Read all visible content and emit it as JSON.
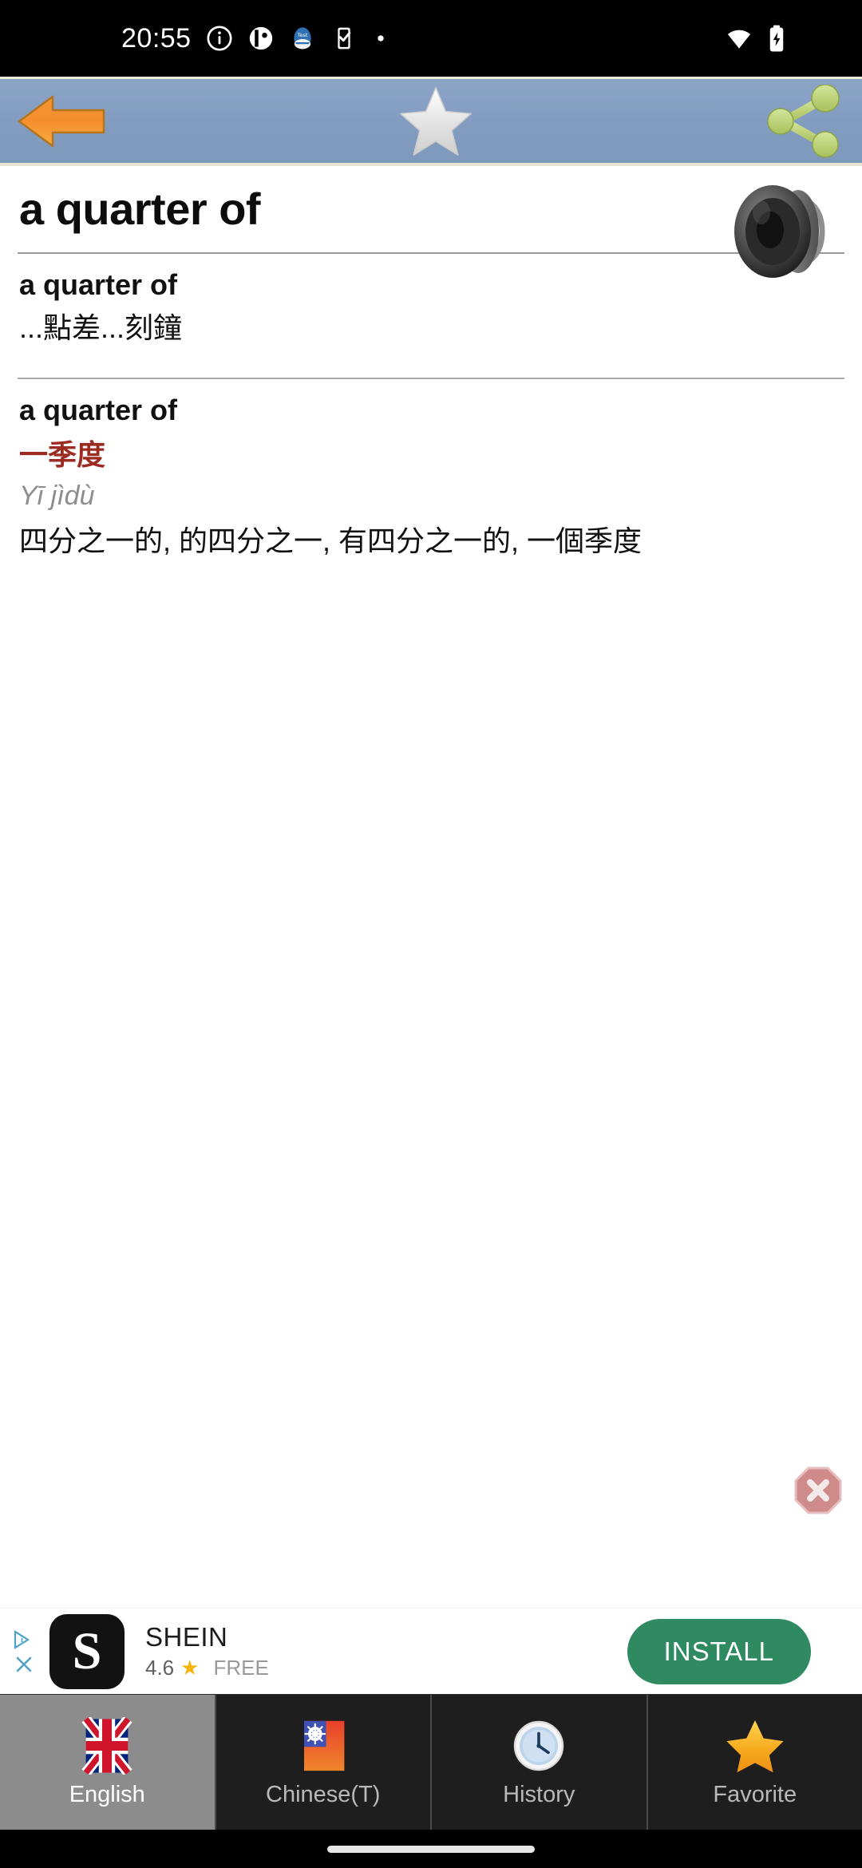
{
  "status_bar": {
    "time": "20:55",
    "left_icons": [
      "info-circle-icon",
      "contacts-icon",
      "app-notification-icon",
      "task-check-icon",
      "dot-icon"
    ],
    "right_icons": [
      "wifi-icon",
      "battery-charging-icon"
    ]
  },
  "toolbar": {
    "back_label": "back-arrow",
    "favorite_label": "star",
    "share_label": "share",
    "background_color": "#829cc0"
  },
  "content": {
    "headword": "a quarter of",
    "speaker_label": "speak",
    "entries": [
      {
        "english": "a quarter of",
        "chinese": "...點差...刻鐘"
      },
      {
        "english": "a quarter of",
        "chinese_red": "一季度",
        "pinyin": "Yī jìdù",
        "definitions": "四分之一的, 的四分之一, 有四分之一的, 一個季度"
      }
    ],
    "accent_red": "#9c2b22"
  },
  "ad": {
    "adchoices_label": "AdChoices",
    "app_initial": "S",
    "app_name": "SHEIN",
    "rating": "4.6",
    "star": "★",
    "price": "FREE",
    "install_label": "INSTALL",
    "install_color": "#2f8a62",
    "close_label": "close-ad"
  },
  "bottom_nav": {
    "items": [
      {
        "label": "English",
        "icon": "uk-flag-icon",
        "active": true
      },
      {
        "label": "Chinese(T)",
        "icon": "taiwan-flag-icon",
        "active": false
      },
      {
        "label": "History",
        "icon": "clock-icon",
        "active": false
      },
      {
        "label": "Favorite",
        "icon": "star-icon",
        "active": false
      }
    ]
  }
}
